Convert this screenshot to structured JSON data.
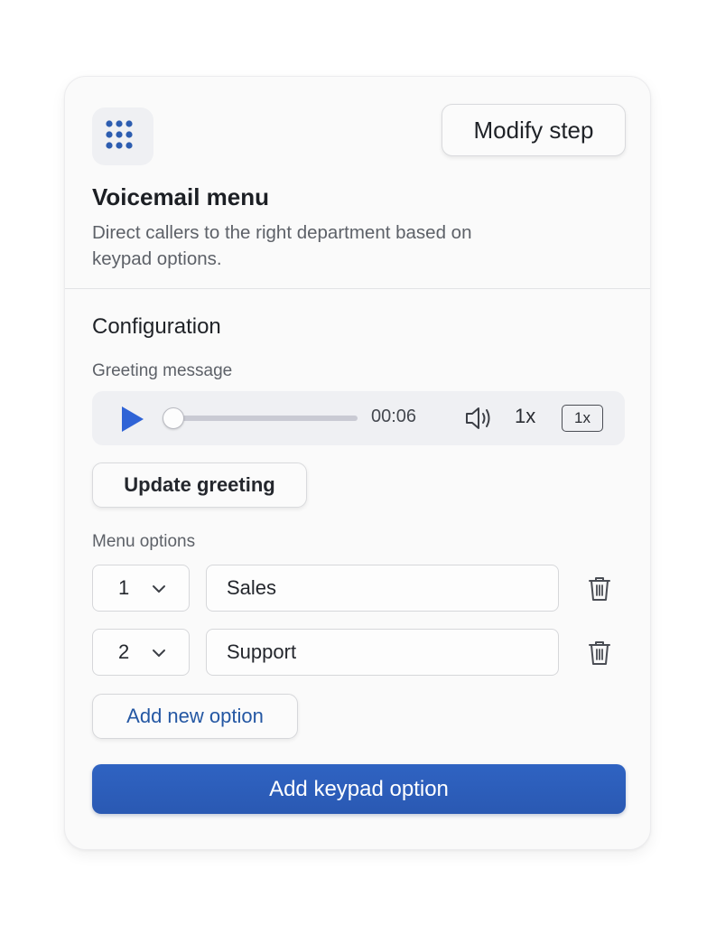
{
  "header": {
    "icon": "keypad-grid-icon",
    "modify_label": "Modify step",
    "title": "Voicemail menu",
    "description": "Direct callers to the right department based on keypad options."
  },
  "configuration": {
    "title": "Configuration",
    "greeting_label": "Greeting message",
    "player": {
      "time": "00:06",
      "progress": 0.0,
      "speed_text": "1x",
      "speed_badge": "1x",
      "play_icon": "play-icon",
      "volume_icon": "volume-icon"
    },
    "update_greeting_label": "Update greeting",
    "menu_options_label": "Menu options",
    "options": [
      {
        "key": "1",
        "label": "Sales"
      },
      {
        "key": "2",
        "label": "Support"
      }
    ],
    "add_new_option_label": "Add new option",
    "add_keypad_label": "Add keypad option"
  },
  "colors": {
    "accent": "#2f63c2",
    "link": "#2457a3",
    "play": "#2f63d6"
  }
}
